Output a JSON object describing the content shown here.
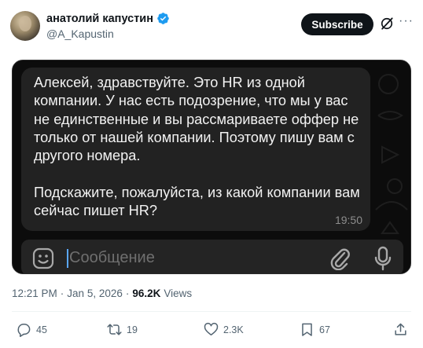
{
  "author": {
    "display_name": "анатолий капустин",
    "handle": "@A_Kapustin",
    "verified": true
  },
  "header": {
    "subscribe_label": "Subscribe",
    "more_label": "···"
  },
  "media": {
    "message_text": "Алексей, здравствуйте. Это HR из одной компании. У нас есть подозрение, что мы у вас не единственные и вы рассмариваете оффер не только от нашей компании. Поэтому пишу вам с другого номера.\n\nПодскажите, пожалуйста, из какой компании вам сейчас пишет HR?",
    "message_time": "19:50",
    "compose_placeholder": "Сообщение"
  },
  "meta": {
    "time": "12:21 PM",
    "separator": "·",
    "date": "Jan 5, 2026",
    "views_count": "96.2K",
    "views_label": "Views"
  },
  "actions": {
    "replies": "45",
    "reposts": "19",
    "likes": "2.3K",
    "bookmarks": "67"
  },
  "colors": {
    "accent": "#1d9bf0",
    "text": "#0f1419",
    "muted": "#536471",
    "bubble": "#222222",
    "media_bg": "#0c0c0c"
  }
}
